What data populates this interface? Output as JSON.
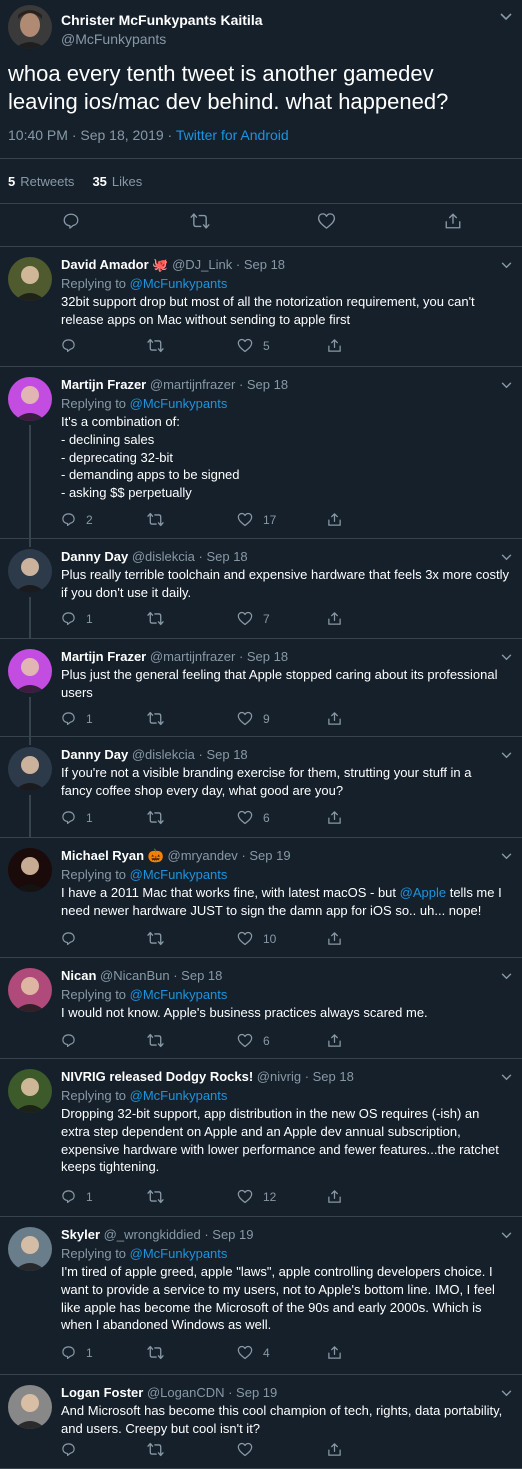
{
  "main_tweet": {
    "author_name": "Christer McFunkypants Kaitila",
    "author_handle": "@McFunkypants",
    "text": "whoa every tenth tweet is another gamedev leaving ios/mac dev behind. what happened?",
    "time": "10:40 PM · Sep 18, 2019 · ",
    "source": "Twitter for Android",
    "retweets_count": "5",
    "retweets_label": "Retweets",
    "likes_count": "35",
    "likes_label": "Likes"
  },
  "replies": [
    {
      "name": "David Amador",
      "emoji": "🐙",
      "handle": "@DJ_Link",
      "date": "· Sep 18",
      "replying_prefix": "Replying to ",
      "replying_to": "@McFunkypants",
      "lines": [
        "32bit support drop but most of all the notorization requirement, you can't",
        "release apps on Mac without sending to apple first"
      ],
      "reply_count": "",
      "like_count": "5",
      "avatar_color": "#4f5a2e"
    },
    {
      "name": "Martijn Frazer",
      "emoji": "",
      "handle": "@martijnfrazer",
      "date": "· Sep 18",
      "replying_prefix": "Replying to ",
      "replying_to": "@McFunkypants",
      "lines": [
        "It's a combination of:",
        "- declining sales",
        "- deprecating 32-bit",
        "- demanding apps to be signed",
        "- asking $$ perpetually"
      ],
      "reply_count": "2",
      "like_count": "17",
      "avatar_color": "#c34de0"
    },
    {
      "name": "Danny Day",
      "emoji": "",
      "handle": "@dislekcia",
      "date": "· Sep 18",
      "replying_prefix": "",
      "replying_to": "",
      "lines": [
        "Plus really terrible toolchain and expensive hardware that feels 3x more costly",
        "if you don't use it daily."
      ],
      "reply_count": "1",
      "like_count": "7",
      "avatar_color": "#2d3a4a"
    },
    {
      "name": "Martijn Frazer",
      "emoji": "",
      "handle": "@martijnfrazer",
      "date": "· Sep 18",
      "replying_prefix": "",
      "replying_to": "",
      "lines": [
        "Plus just the general feeling that Apple stopped caring about its professional",
        "users"
      ],
      "reply_count": "1",
      "like_count": "9",
      "avatar_color": "#c34de0"
    },
    {
      "name": "Danny Day",
      "emoji": "",
      "handle": "@dislekcia",
      "date": "· Sep 18",
      "replying_prefix": "",
      "replying_to": "",
      "lines": [
        "If you're not a visible branding exercise for them, strutting your stuff in a",
        "fancy coffee shop every day, what good are you?"
      ],
      "reply_count": "1",
      "like_count": "6",
      "avatar_color": "#2d3a4a"
    },
    {
      "name": "Michael Ryan",
      "emoji": "🎃",
      "handle": "@mryandev",
      "date": "· Sep 19",
      "replying_prefix": "Replying to ",
      "replying_to": "@McFunkypants",
      "lines_rich": [
        {
          "pre": "I have a 2011 Mac that works fine, with latest macOS  - but ",
          "link": "@Apple",
          "post": " tells me I"
        },
        {
          "pre": "need newer hardware JUST to sign the damn app for iOS so.. uh... nope!",
          "link": "",
          "post": ""
        }
      ],
      "reply_count": "",
      "like_count": "10",
      "avatar_color": "#1a0a0a"
    },
    {
      "name": "Nican",
      "emoji": "",
      "handle": "@NicanBun",
      "date": "· Sep 18",
      "replying_prefix": "Replying to ",
      "replying_to": "@McFunkypants",
      "lines": [
        "I would not know. Apple's business practices always scared me."
      ],
      "reply_count": "",
      "like_count": "6",
      "avatar_color": "#b04a7a"
    },
    {
      "name": "NIVRIG released Dodgy Rocks!",
      "emoji": "",
      "handle": "@nivrig",
      "date": "· Sep 18",
      "replying_prefix": "Replying to ",
      "replying_to": "@McFunkypants",
      "lines": [
        "Dropping 32-bit support, app distribution in the new OS requires (-ish) an",
        "extra step dependent on Apple and an Apple dev annual subscription,",
        "expensive hardware with lower performance and fewer features...the ratchet",
        "keeps tightening."
      ],
      "reply_count": "1",
      "like_count": "12",
      "avatar_color": "#3c5a2a"
    },
    {
      "name": "Skyler",
      "emoji": "",
      "handle": "@_wrongkiddied",
      "date": "· Sep 19",
      "replying_prefix": "Replying to ",
      "replying_to": "@McFunkypants",
      "lines": [
        "I'm tired of apple greed, apple \"laws\", apple controlling developers choice. I",
        "want to provide a service to my users, not to Apple's bottom line. IMO, I feel",
        "like apple has become the Microsoft of the 90s and early 2000s. Which is",
        "when I abandoned Windows as well."
      ],
      "reply_count": "1",
      "like_count": "4",
      "avatar_color": "#6a7d8a"
    },
    {
      "name": "Logan Foster",
      "emoji": "",
      "handle": "@LoganCDN",
      "date": "· Sep 19",
      "replying_prefix": "",
      "replying_to": "",
      "lines": [
        "And Microsoft has become this cool champion of tech, rights, data portability,",
        "and users. Creepy but cool isn't it?"
      ],
      "reply_count": "",
      "like_count": "",
      "avatar_color": "#888888"
    }
  ],
  "colors": {
    "background": "#15202b",
    "divider": "#38444d",
    "secondary_text": "#8899a6",
    "link": "#1b95e0"
  }
}
